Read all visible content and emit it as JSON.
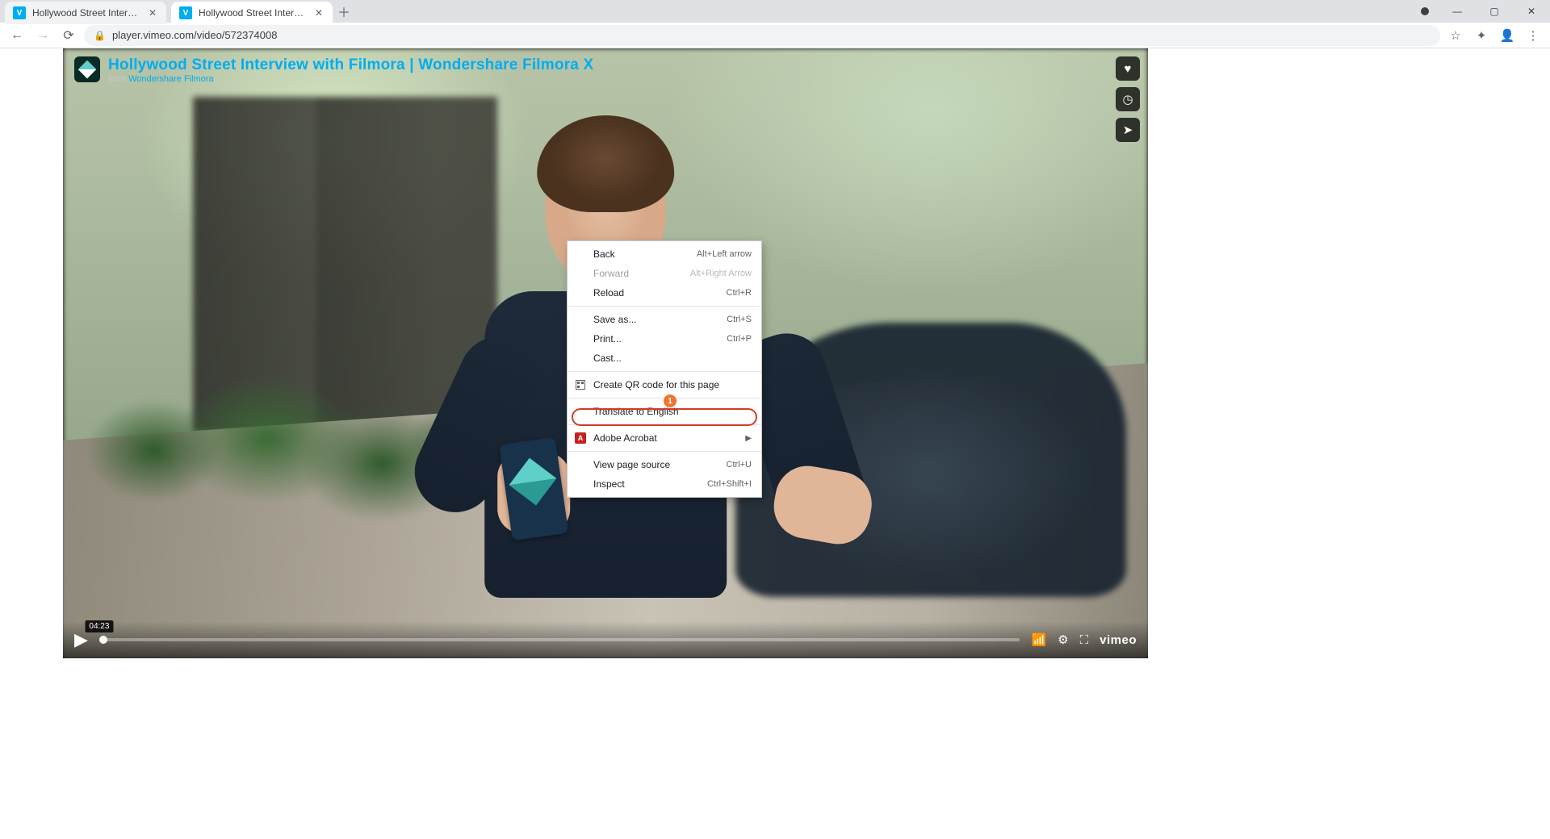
{
  "tabs": [
    {
      "title": "Hollywood Street Interview with …"
    },
    {
      "title": "Hollywood Street Interview with …"
    }
  ],
  "url": "player.vimeo.com/video/572374008",
  "video": {
    "title": "Hollywood Street Interview with Filmora | Wondershare Filmora X",
    "from_prefix": "from ",
    "author": "Wondershare Filmora",
    "timecode": "04:23",
    "vimeo": "vimeo"
  },
  "context_menu": {
    "back": {
      "label": "Back",
      "shortcut": "Alt+Left arrow"
    },
    "forward": {
      "label": "Forward",
      "shortcut": "Alt+Right Arrow"
    },
    "reload": {
      "label": "Reload",
      "shortcut": "Ctrl+R"
    },
    "save_as": {
      "label": "Save as...",
      "shortcut": "Ctrl+S"
    },
    "print": {
      "label": "Print...",
      "shortcut": "Ctrl+P"
    },
    "cast": {
      "label": "Cast..."
    },
    "qr": {
      "label": "Create QR code for this page"
    },
    "translate": {
      "label": "Translate to English"
    },
    "acrobat": {
      "label": "Adobe Acrobat"
    },
    "view_source": {
      "label": "View page source",
      "shortcut": "Ctrl+U"
    },
    "inspect": {
      "label": "Inspect",
      "shortcut": "Ctrl+Shift+I"
    }
  },
  "annotation": {
    "badge": "1"
  }
}
